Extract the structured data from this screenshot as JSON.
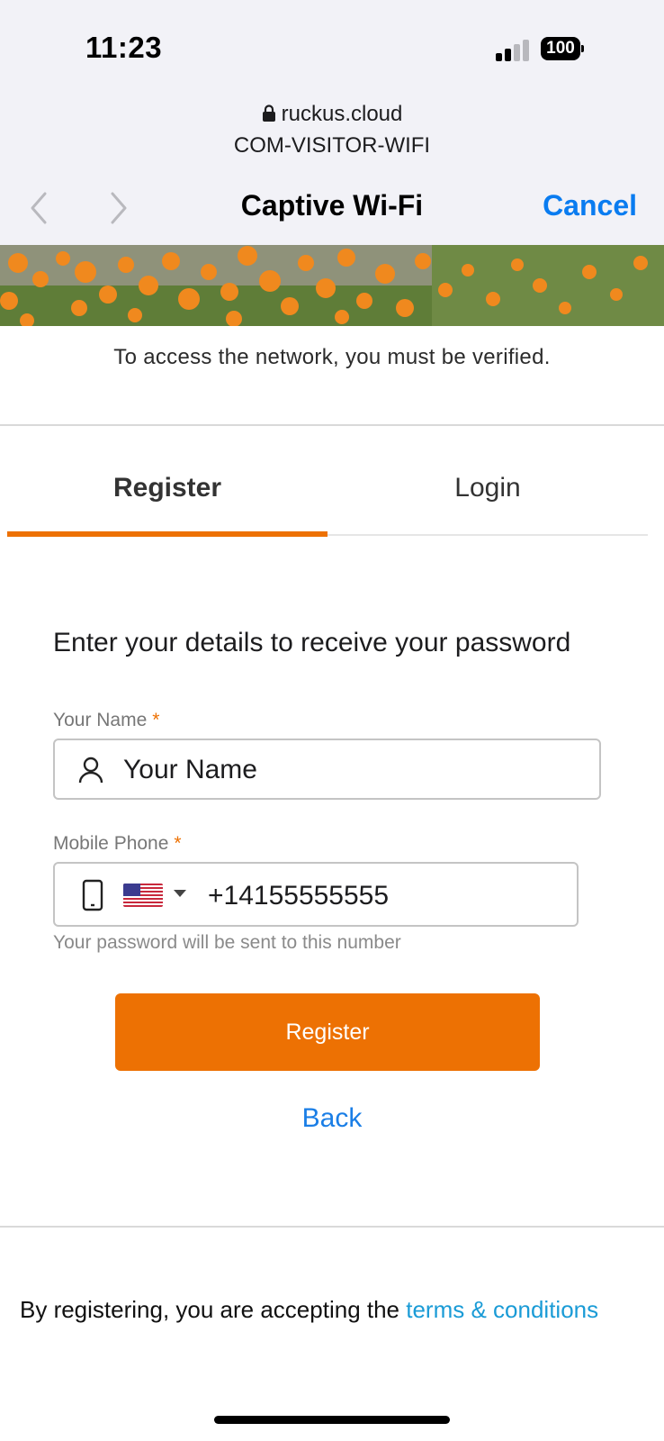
{
  "status_bar": {
    "time": "11:23",
    "battery": "100"
  },
  "browser": {
    "domain": "ruckus.cloud",
    "network_name": "COM-VISITOR-WIFI",
    "title": "Captive Wi-Fi",
    "cancel_label": "Cancel"
  },
  "portal": {
    "notice": "To access the network, you must be verified.",
    "tabs": [
      {
        "label": "Register",
        "active": true
      },
      {
        "label": "Login",
        "active": false
      }
    ],
    "headline": "Enter your details to receive your password",
    "name_field": {
      "label": "Your Name",
      "required_mark": "*",
      "placeholder": "Your Name"
    },
    "phone_field": {
      "label": "Mobile Phone",
      "required_mark": "*",
      "country_flag": "us-flag-icon",
      "value": "+14155555555",
      "hint": "Your password will be sent to this number"
    },
    "register_button": "Register",
    "back_link": "Back",
    "footer": {
      "text": "By registering, you are accepting the ",
      "link": "terms & conditions"
    }
  },
  "colors": {
    "accent": "#ed7103",
    "link": "#1a7ee6",
    "ios_blue": "#0a7cf0",
    "chrome_bg": "#f2f2f7"
  }
}
